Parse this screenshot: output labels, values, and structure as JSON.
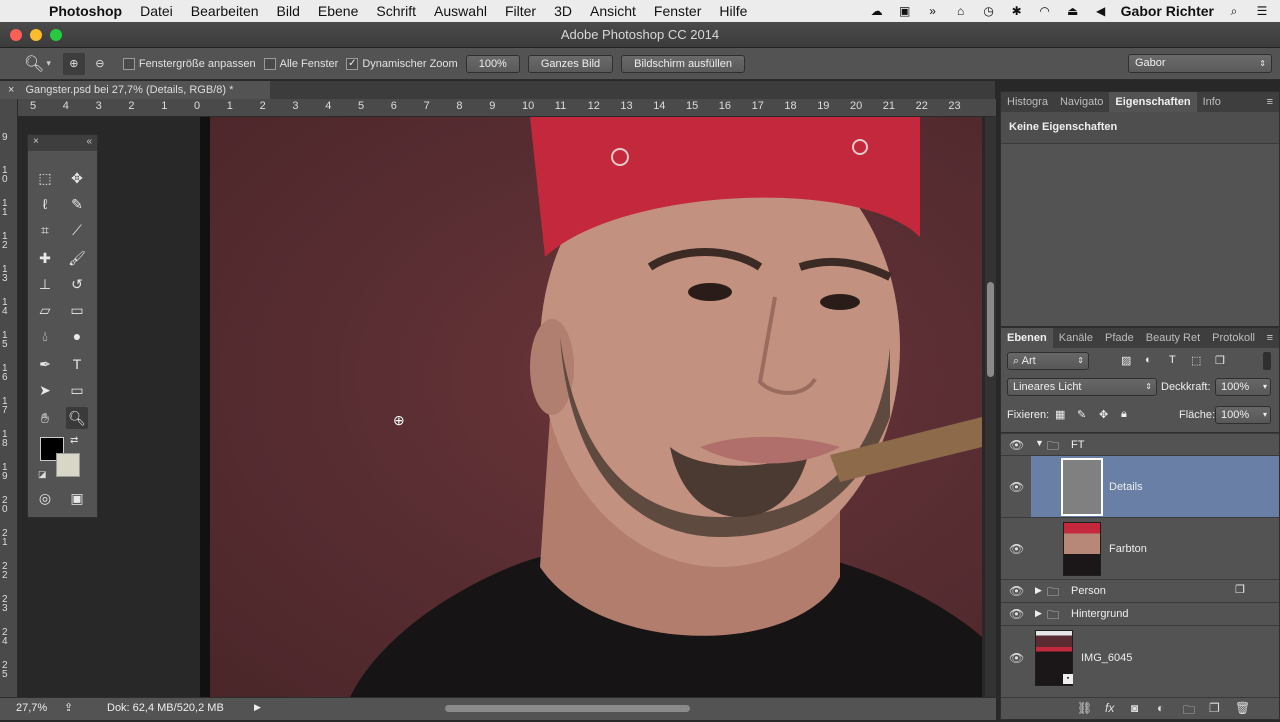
{
  "menubar": {
    "app": "Photoshop",
    "items": [
      "Datei",
      "Bearbeiten",
      "Bild",
      "Ebene",
      "Schrift",
      "Auswahl",
      "Filter",
      "3D",
      "Ansicht",
      "Fenster",
      "Hilfe"
    ],
    "user": "Gabor Richter"
  },
  "window": {
    "title": "Adobe Photoshop CC 2014"
  },
  "options": {
    "resize_windows": "Fenstergröße anpassen",
    "all_windows": "Alle Fenster",
    "scrubby_zoom": "Dynamischer Zoom",
    "zoom_100": "100%",
    "fit_screen": "Ganzes Bild",
    "fill_screen": "Bildschirm ausfüllen",
    "workspace": "Gabor"
  },
  "document": {
    "tab_title": "Gangster.psd bei 27,7% (Details, RGB/8) *",
    "ruler_h": [
      "5",
      "4",
      "3",
      "2",
      "1",
      "0",
      "1",
      "2",
      "3",
      "4",
      "5",
      "6",
      "7",
      "8",
      "9",
      "10",
      "11",
      "12",
      "13",
      "14",
      "15",
      "16",
      "17",
      "18",
      "19",
      "20",
      "21",
      "22",
      "23"
    ],
    "ruler_v": [
      "9",
      "10",
      "11",
      "12",
      "13",
      "14",
      "15",
      "16",
      "17",
      "18",
      "19",
      "20",
      "21",
      "22",
      "23",
      "24",
      "25"
    ]
  },
  "status": {
    "zoom": "27,7%",
    "doc_size": "Dok: 62,4 MB/520,2 MB"
  },
  "properties": {
    "tabs": [
      "Histogra",
      "Navigato",
      "Eigenschaften",
      "Info"
    ],
    "active": "Eigenschaften",
    "empty_text": "Keine Eigenschaften"
  },
  "layers_panel": {
    "tabs": [
      "Ebenen",
      "Kanäle",
      "Pfade",
      "Beauty Ret",
      "Protokoll"
    ],
    "filter": "Art",
    "blend_mode": "Lineares Licht",
    "opacity_label": "Deckkraft:",
    "opacity": "100%",
    "lock_label": "Fixieren:",
    "fill_label": "Fläche:",
    "fill": "100%",
    "layers": [
      {
        "name": "FT",
        "type": "group",
        "expanded": true
      },
      {
        "name": "Details",
        "type": "layer",
        "selected": true
      },
      {
        "name": "Farbton",
        "type": "layer"
      },
      {
        "name": "Person",
        "type": "group",
        "expanded": false
      },
      {
        "name": "Hintergrund",
        "type": "group",
        "expanded": false
      },
      {
        "name": "IMG_6045",
        "type": "smart-object"
      }
    ]
  },
  "colors": {
    "selection": "#6a7fa5",
    "panel": "#535353",
    "foreground": "#000000",
    "background": "#d8d6c6"
  }
}
